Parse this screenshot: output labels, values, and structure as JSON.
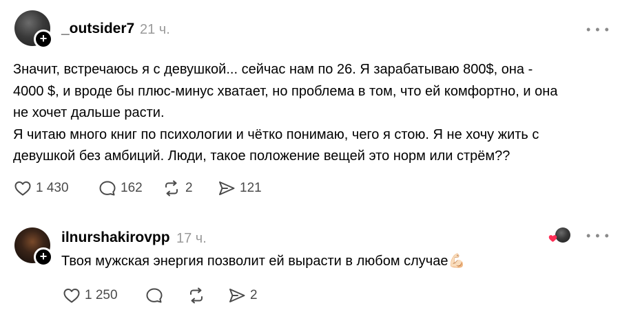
{
  "post": {
    "username": "_outsider7",
    "time": "21 ч.",
    "text": "Значит, встречаюсь я с девушкой... сейчас нам по 26. Я зарабатываю 800$, она -\n4000 $, и вроде бы плюс-минус хватает, но проблема в том, что ей комфортно, и она\nне хочет дальше расти.\nЯ читаю много книг по психологии и чётко понимаю, чего я стою. Я не хочу жить с\nдевушкой без амбиций. Люди, такое положение вещей это норм или стрём??",
    "likes": "1 430",
    "comments": "162",
    "reposts": "2",
    "shares": "121"
  },
  "reply": {
    "username": "ilnurshakirovpp",
    "time": "17 ч.",
    "text": "Твоя мужская энергия позволит ей вырасти в любом случае",
    "emoji": "💪🏻",
    "likes": "1 250",
    "shares": "2"
  },
  "icons": {
    "more": "more-dots-icon",
    "follow": "plus-icon",
    "like": "heart-icon",
    "comment": "comment-icon",
    "repost": "repost-icon",
    "share": "send-icon"
  },
  "colors": {
    "heart_badge": "#ff2d55",
    "muted_text": "#9a9a9a",
    "icon_gray": "#4a4a4a"
  }
}
